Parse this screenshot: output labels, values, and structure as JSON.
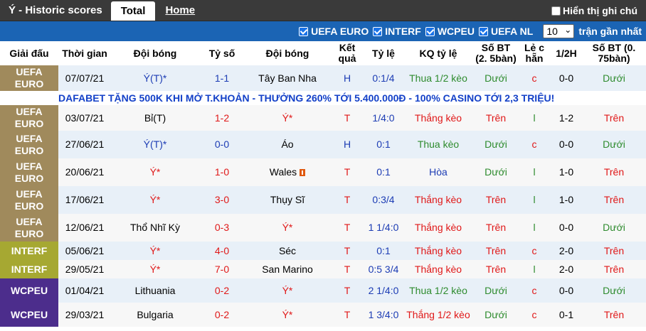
{
  "topbar": {
    "title": "Ý - Historic scores",
    "tab_total": "Total",
    "tab_home": "Home",
    "hint": "Hiển thị ghi chú"
  },
  "filter": {
    "items": [
      "UEFA EURO",
      "INTERF",
      "WCPEU",
      "UEFA NL"
    ],
    "count": "10",
    "recent": "trận gần nhất"
  },
  "headers": {
    "league": "Giải đấu",
    "date": "Thời gian",
    "home": "Đội bóng",
    "score": "Tỷ số",
    "away": "Đội bóng",
    "result": "Kết quả",
    "odds": "Tỷ lệ",
    "kq_odds": "KQ tỷ lệ",
    "goals25": "Số BT (2. 5bàn)",
    "oddeven": "Lẻ c hẵn",
    "half": "1/2H",
    "goals075": "Số BT (0. 75bàn)"
  },
  "promo": "DAFABET TẶNG 500K KHI MỞ T.KHOẢN - THƯỞNG 260% TỚI 5.400.000Đ - 100% CASINO TỚI 2,3 TRIỆU!",
  "colors": {
    "uefa_euro": "#a08a5c",
    "interf": "#a6a832",
    "wcpeu": "#4c2d8c",
    "filter_bar": "#1b64b4",
    "topbar": "#3a3a3a"
  },
  "rows": [
    {
      "league": "UEFA EURO",
      "date": "07/07/21",
      "home": "Ý(T)*",
      "score": "1-1",
      "away": "Tây Ban Nha",
      "result": "H",
      "odds": "0:1/4",
      "kq": "Thua 1/2 kèo",
      "bt25": "Dưới",
      "oe": "c",
      "half": "0-0",
      "bt075": "Dưới"
    },
    {
      "league": "UEFA EURO",
      "date": "03/07/21",
      "home": "Bỉ(T)",
      "score": "1-2",
      "away": "Ý*",
      "result": "T",
      "odds": "1/4:0",
      "kq": "Thắng kèo",
      "bt25": "Trên",
      "oe": "l",
      "half": "1-2",
      "bt075": "Trên"
    },
    {
      "league": "UEFA EURO",
      "date": "27/06/21",
      "home": "Ý(T)*",
      "score": "0-0",
      "away": "Áo",
      "result": "H",
      "odds": "0:1",
      "kq": "Thua kèo",
      "bt25": "Dưới",
      "oe": "c",
      "half": "0-0",
      "bt075": "Dưới"
    },
    {
      "league": "UEFA EURO",
      "date": "20/06/21",
      "home": "Ý*",
      "score": "1-0",
      "away": "Wales",
      "result": "T",
      "odds": "0:1",
      "kq": "Hòa",
      "bt25": "Dưới",
      "oe": "l",
      "half": "1-0",
      "bt075": "Trên"
    },
    {
      "league": "UEFA EURO",
      "date": "17/06/21",
      "home": "Ý*",
      "score": "3-0",
      "away": "Thụy Sĩ",
      "result": "T",
      "odds": "0:3/4",
      "kq": "Thắng kèo",
      "bt25": "Trên",
      "oe": "l",
      "half": "1-0",
      "bt075": "Trên"
    },
    {
      "league": "UEFA EURO",
      "date": "12/06/21",
      "home": "Thổ Nhĩ Kỳ",
      "score": "0-3",
      "away": "Ý*",
      "result": "T",
      "odds": "1 1/4:0",
      "kq": "Thắng kèo",
      "bt25": "Trên",
      "oe": "l",
      "half": "0-0",
      "bt075": "Dưới"
    },
    {
      "league": "INTERF",
      "date": "05/06/21",
      "home": "Ý*",
      "score": "4-0",
      "away": "Séc",
      "result": "T",
      "odds": "0:1",
      "kq": "Thắng kèo",
      "bt25": "Trên",
      "oe": "c",
      "half": "2-0",
      "bt075": "Trên"
    },
    {
      "league": "INTERF",
      "date": "29/05/21",
      "home": "Ý*",
      "score": "7-0",
      "away": "San Marino",
      "result": "T",
      "odds": "0:5 3/4",
      "kq": "Thắng kèo",
      "bt25": "Trên",
      "oe": "l",
      "half": "2-0",
      "bt075": "Trên"
    },
    {
      "league": "WCPEU",
      "date": "01/04/21",
      "home": "Lithuania",
      "score": "0-2",
      "away": "Ý*",
      "result": "T",
      "odds": "2 1/4:0",
      "kq": "Thua 1/2 kèo",
      "bt25": "Dưới",
      "oe": "c",
      "half": "0-0",
      "bt075": "Dưới"
    },
    {
      "league": "WCPEU",
      "date": "29/03/21",
      "home": "Bulgaria",
      "score": "0-2",
      "away": "Ý*",
      "result": "T",
      "odds": "1 3/4:0",
      "kq": "Thắng 1/2 kèo",
      "bt25": "Dưới",
      "oe": "c",
      "half": "0-1",
      "bt075": "Trên"
    }
  ]
}
